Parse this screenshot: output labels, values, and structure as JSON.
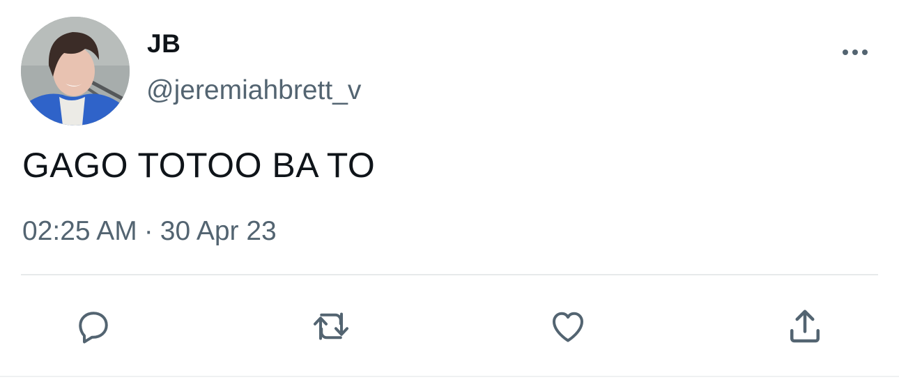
{
  "author": {
    "display_name": "JB",
    "handle": "@jeremiahbrett_v"
  },
  "tweet": {
    "text": "GAGO TOTOO BA TO",
    "time": "02:25 AM",
    "separator": "·",
    "date": "30 Apr 23"
  },
  "actions": [
    {
      "name": "reply",
      "icon": "reply-icon"
    },
    {
      "name": "retweet",
      "icon": "retweet-icon"
    },
    {
      "name": "like",
      "icon": "heart-icon"
    },
    {
      "name": "share",
      "icon": "share-icon"
    }
  ],
  "colors": {
    "primary_text": "#0f1419",
    "secondary_text": "#536471",
    "divider": "#e7e9ea"
  }
}
